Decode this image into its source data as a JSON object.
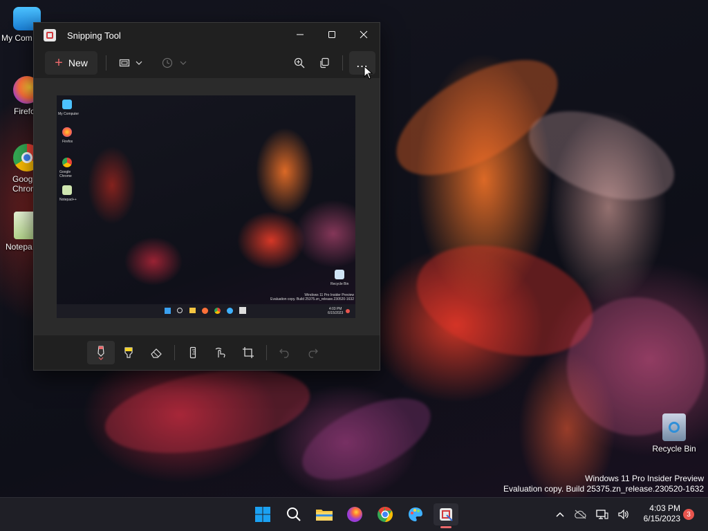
{
  "desktop": {
    "icons": [
      {
        "label": "My Com"
      },
      {
        "label": "Firefo"
      },
      {
        "label": "Goog\nChron"
      },
      {
        "label": "Notepa"
      },
      {
        "label": "Recycle Bin"
      }
    ],
    "watermark": {
      "line1": "Windows 11 Pro Insider Preview",
      "line2": "Evaluation copy. Build 25375.zn_release.230520-1632"
    }
  },
  "window": {
    "title": "Snipping Tool",
    "toolbar": {
      "new_label": "New",
      "more_label": "…"
    },
    "snip_preview": {
      "icon_labels": [
        "My Computer",
        "Firefox",
        "Google Chrome",
        "Notepad++",
        "Recycle Bin"
      ],
      "watermark": "Windows 11 Pro Insider Preview\nEvaluation copy. Build 25375.zn_release.230520-1632",
      "clock": "4:03 PM\n6/15/2023"
    }
  },
  "taskbar": {
    "time": "4:03 PM",
    "date": "6/15/2023",
    "notification_count": "3"
  },
  "colors": {
    "accent": "#e9686b",
    "window_bg": "#202020",
    "taskbar_bg": "#1f1f26",
    "windows_blue": "#1ba1f2"
  }
}
